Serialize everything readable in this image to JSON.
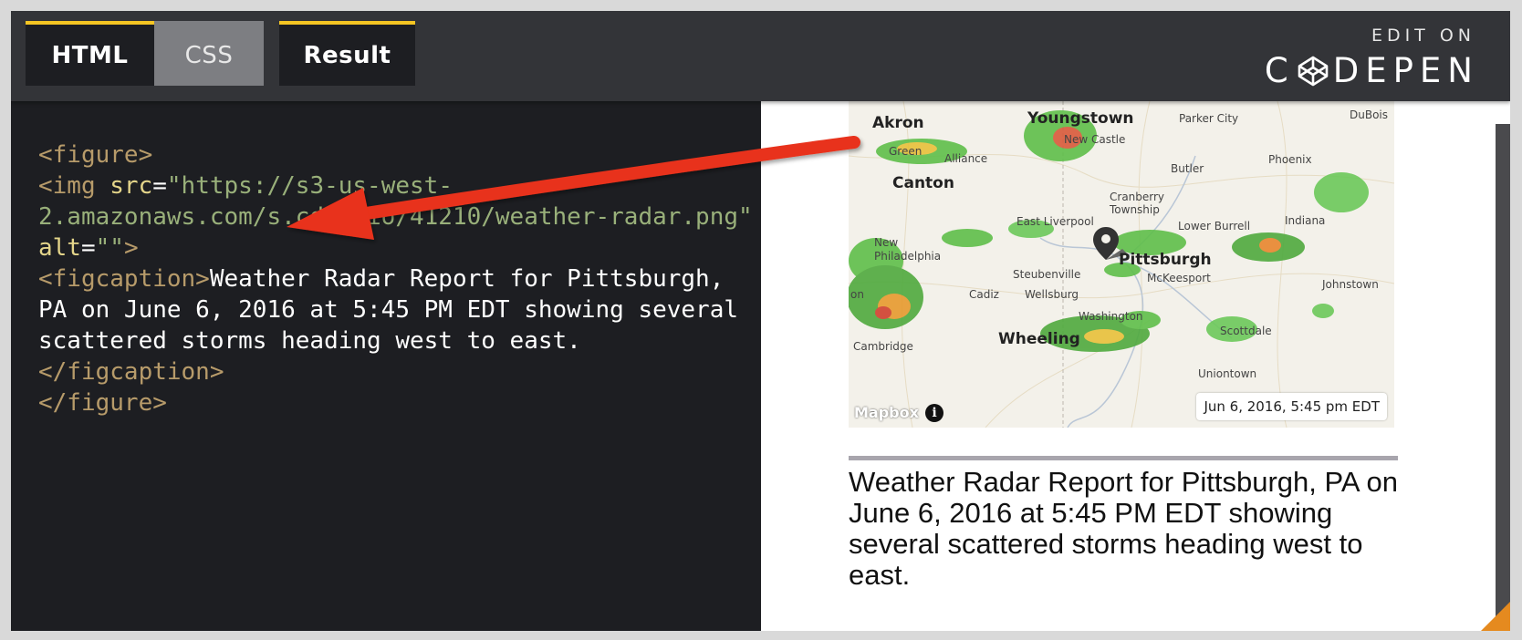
{
  "tabs": {
    "html": "HTML",
    "css": "CSS",
    "result": "Result"
  },
  "brand": {
    "edit_on": "EDIT ON",
    "codepen_pre": "C",
    "codepen_post": "DEPEN"
  },
  "code": {
    "line1": "<figure>",
    "img_open": "<img ",
    "src_attr": "src",
    "eq1": "=",
    "src_value": "\"https://s3-us-west-2.amazonaws.com/s.cdpn.io/41210/weather-radar.png\"",
    "alt_attr": "alt",
    "eq2": "=",
    "alt_value": "\"\"",
    "img_close": ">",
    "figcaption_open": "<figcaption>",
    "caption_text": "Weather Radar Report for Pittsburgh, PA on June 6, 2016 at 5:45 PM EDT showing several scattered storms heading west to east.",
    "figcaption_close": "</figcaption>",
    "figure_close": "</figure>"
  },
  "map": {
    "timestamp": "Jun 6, 2016, 5:45 pm EDT",
    "attribution": "Mapbox",
    "info_glyph": "i",
    "cities": [
      {
        "name": "Akron"
      },
      {
        "name": "Youngstown"
      },
      {
        "name": "Parker City"
      },
      {
        "name": "DuBois"
      },
      {
        "name": "Green"
      },
      {
        "name": "Alliance"
      },
      {
        "name": "New Castle"
      },
      {
        "name": "Phoenix"
      },
      {
        "name": "Canton"
      },
      {
        "name": "Butler"
      },
      {
        "name": "Cranberry Township"
      },
      {
        "name": "East Liverpool"
      },
      {
        "name": "Lower Burrell"
      },
      {
        "name": "Indiana"
      },
      {
        "name": "New Philadelphia"
      },
      {
        "name": "Pittsburgh"
      },
      {
        "name": "Steubenville"
      },
      {
        "name": "McKeesport"
      },
      {
        "name": "Johnstown"
      },
      {
        "name": "Cadiz"
      },
      {
        "name": "Wellsburg"
      },
      {
        "name": "Washington"
      },
      {
        "name": "Scottdale"
      },
      {
        "name": "Cambridge"
      },
      {
        "name": "Wheeling"
      },
      {
        "name": "Uniontown"
      },
      {
        "name": "on"
      }
    ]
  },
  "figure": {
    "caption": "Weather Radar Report for Pittsburgh, PA on June 6, 2016 at 5:45 PM EDT showing several scattered storms heading west to east."
  },
  "colors": {
    "tab_accent": "#f5c523",
    "arrow": "#e8311a",
    "resize_corner": "#e58a1f"
  }
}
